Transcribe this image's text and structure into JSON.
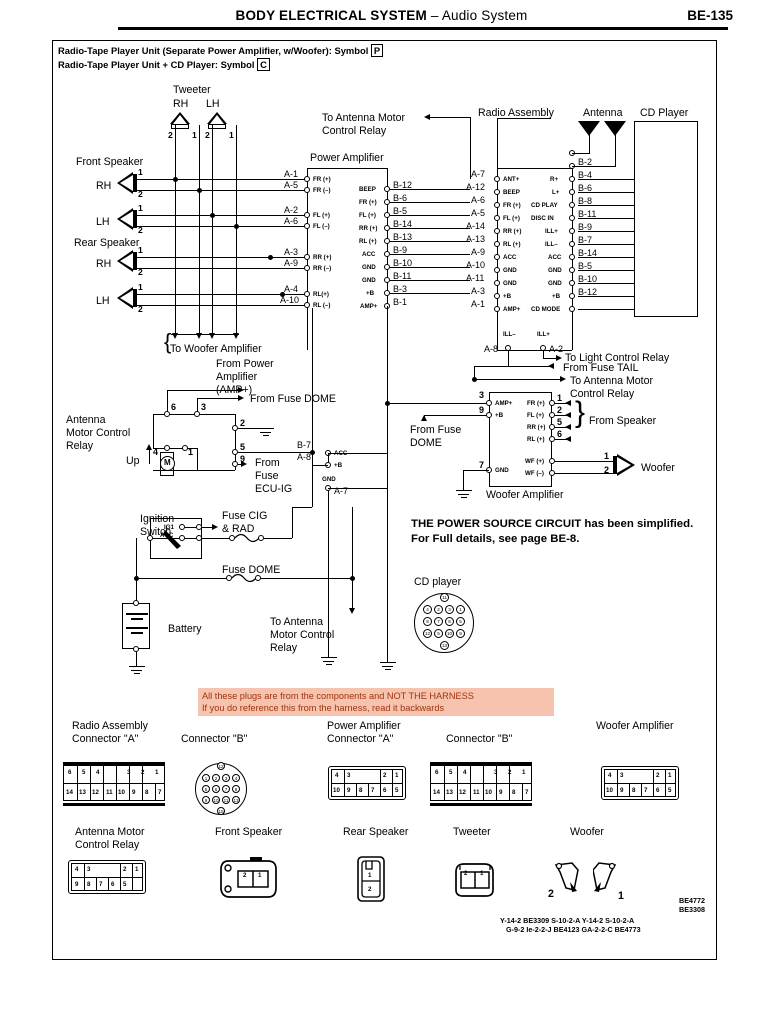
{
  "header": {
    "title_bold": "BODY ELECTRICAL SYSTEM",
    "title_dash": " – ",
    "title_thin": "Audio System",
    "page_number": "BE-135"
  },
  "legend": {
    "line1_text": "Radio-Tape Player Unit (Separate Power Amplifier, w/Woofer): Symbol",
    "line1_symbol": "P",
    "line2_text": "Radio-Tape Player Unit + CD Player: Symbol",
    "line2_symbol": "C"
  },
  "labels": {
    "tweeter": "Tweeter",
    "tweeter_rh": "RH",
    "tweeter_lh": "LH",
    "front_speaker": "Front Speaker",
    "rear_speaker": "Rear Speaker",
    "rh": "RH",
    "lh": "LH",
    "power_amplifier": "Power Amplifier",
    "radio_assembly": "Radio Assembly",
    "antenna": "Antenna",
    "cd_player": "CD Player",
    "to_antenna_motor_l1": "To Antenna Motor",
    "to_antenna_motor_l2": "Control Relay",
    "to_woofer_amplifier": "To Woofer Amplifier",
    "from_power_amp_l1": "From Power",
    "from_power_amp_l2": "Amplifier",
    "from_power_amp_l3": "(AMP+)",
    "from_fuse_dome_inline": "From Fuse DOME",
    "antenna_motor_relay_l1": "Antenna",
    "antenna_motor_relay_l2": "Motor Control",
    "antenna_motor_relay_l3": "Relay",
    "up": "Up",
    "from_fuse_ecuig_l1": "From",
    "from_fuse_ecuig_l2": "Fuse",
    "from_fuse_ecuig_l3": "ECU-IG",
    "from_fuse_dome_l1": "From Fuse",
    "from_fuse_dome_l2": "DOME",
    "ignition_switch_l1": "Ignition",
    "ignition_switch_l2": "Switch",
    "ig1": "IG1",
    "acc": "ACC",
    "fuse_cig_l1": "Fuse CIG",
    "fuse_cig_l2": "& RAD",
    "fuse_dome": "Fuse DOME",
    "battery": "Battery",
    "to_antenna_motor_relay_l1": "To Antenna",
    "to_antenna_motor_relay_l2": "Motor Control",
    "to_antenna_motor_relay_l3": "Relay",
    "to_light_control_relay": "To Light Control Relay",
    "from_fuse_tail": "From Fuse TAIL",
    "to_antenna_motor_b_l1": "To Antenna Motor",
    "to_antenna_motor_b_l2": "Control Relay",
    "from_speaker": "From Speaker",
    "woofer": "Woofer",
    "woofer_amplifier": "Woofer Amplifier",
    "power_source_l1": "THE POWER SOURCE CIRCUIT has been simplified.",
    "power_source_l2": "For Full details, see page BE-8.",
    "cd_player_connector": "CD player"
  },
  "note": {
    "line1": "All these plugs are from the components and NOT THE HARNESS",
    "line2": "If you do reference this from the harness, read it backwards",
    "bg_color": "#f6c4ae",
    "text_color": "#a0330f"
  },
  "power_amp_connector_a": {
    "pins": [
      {
        "wire": "A-1",
        "name": "FR (+)"
      },
      {
        "wire": "A-5",
        "name": "FR (–)"
      },
      {
        "wire": "A-2",
        "name": "FL (+)"
      },
      {
        "wire": "A-6",
        "name": "FL (–)"
      },
      {
        "wire": "A-3",
        "name": "RR (+)"
      },
      {
        "wire": "A-9",
        "name": "RR (–)"
      },
      {
        "wire": "A-4",
        "name": "RL(+)"
      },
      {
        "wire": "A-10",
        "name": "RL (–)"
      }
    ]
  },
  "power_amp_connector_b": {
    "pins": [
      {
        "name": "BEEP",
        "wire": "B-12"
      },
      {
        "name": "FR (+)",
        "wire": "B-6"
      },
      {
        "name": "FL (+)",
        "wire": "B-5"
      },
      {
        "name": "RR (+)",
        "wire": "B-14"
      },
      {
        "name": "RL (+)",
        "wire": "B-13"
      },
      {
        "name": "ACC",
        "wire": "B-9"
      },
      {
        "name": "GND",
        "wire": "B-10"
      },
      {
        "name": "GND",
        "wire": "B-11"
      },
      {
        "name": "+B",
        "wire": "B-3"
      },
      {
        "name": "AMP+",
        "wire": "B-1"
      }
    ]
  },
  "radio_connector_a": {
    "pins": [
      {
        "wire": "A-7",
        "name": "ANT+"
      },
      {
        "wire": "A-12",
        "name": "BEEP"
      },
      {
        "wire": "A-6",
        "name": "FR (+)"
      },
      {
        "wire": "A-5",
        "name": "FL (+)"
      },
      {
        "wire": "A-14",
        "name": "RR (+)"
      },
      {
        "wire": "A-13",
        "name": "RL (+)"
      },
      {
        "wire": "A-9",
        "name": "ACC"
      },
      {
        "wire": "A-10",
        "name": "GND"
      },
      {
        "wire": "A-11",
        "name": "GND"
      },
      {
        "wire": "A-3",
        "name": "+B"
      },
      {
        "wire": "A-1",
        "name": "AMP+"
      }
    ],
    "ill_minus": {
      "name": "ILL–",
      "wire": "A-8"
    },
    "ill_plus": {
      "name": "ILL+",
      "wire": "A-2"
    }
  },
  "radio_connector_b": {
    "pins": [
      {
        "name": "",
        "wire": "B-2"
      },
      {
        "name": "R+",
        "wire": "B-4"
      },
      {
        "name": "L+",
        "wire": "B-6"
      },
      {
        "name": "CD PLAY",
        "wire": "B-8"
      },
      {
        "name": "DISC IN",
        "wire": "B-11"
      },
      {
        "name": "ILL+",
        "wire": "B-9"
      },
      {
        "name": "ILL–",
        "wire": "B-7"
      },
      {
        "name": "ACC",
        "wire": "B-14"
      },
      {
        "name": "GND",
        "wire": "B-5"
      },
      {
        "name": "GND",
        "wire": "B-10"
      },
      {
        "name": "+B",
        "wire": "B-12"
      },
      {
        "name": "CD MODE",
        "wire": ""
      }
    ]
  },
  "woofer_amp": {
    "left_pins": [
      {
        "num": "3",
        "name": "AMP+"
      },
      {
        "num": "9",
        "name": "+B"
      },
      {
        "num": "7",
        "name": "GND"
      }
    ],
    "right_pins": [
      {
        "name": "FR (+)",
        "num": "1"
      },
      {
        "name": "FL (+)",
        "num": "2"
      },
      {
        "name": "RR (+)",
        "num": "5"
      },
      {
        "name": "RL (+)",
        "num": "6"
      }
    ],
    "woofer_pins": [
      {
        "name": "WF (+)",
        "num": "1"
      },
      {
        "name": "WF (–)",
        "num": "2"
      }
    ]
  },
  "antenna_relay": {
    "terminals": [
      "6",
      "3",
      "2",
      "5",
      "9",
      "4",
      "1"
    ]
  },
  "amp_junction": {
    "b7": "B-7",
    "acc": "ACC",
    "a8": "A-8",
    "plusb": "+B",
    "gnd": "GND",
    "a7": "A-7"
  },
  "speaker_pins": {
    "front_rh": [
      "1",
      "2"
    ],
    "front_lh": [
      "1",
      "2"
    ],
    "rear_rh": [
      "1",
      "2"
    ],
    "rear_lh": [
      "1",
      "2"
    ],
    "tweeter_rh": [
      "2",
      "1"
    ],
    "tweeter_lh": [
      "2",
      "1"
    ]
  },
  "cd_round_connector": {
    "top": "11",
    "row1": [
      "4",
      "2",
      "3",
      "1"
    ],
    "row2": [
      "8",
      "7",
      "6",
      "5"
    ],
    "row3": [
      "12",
      "5",
      "10",
      "9"
    ],
    "bottom": "13"
  },
  "connectors": [
    {
      "id": "radio-assembly-connector-a",
      "title_l1": "Radio Assembly",
      "title_l2": "Connector \"A\"",
      "type": "grid14-shroud",
      "top_row": [
        "6",
        "5",
        "4",
        "",
        "3",
        "2",
        "1"
      ],
      "bottom_row": [
        "14",
        "13",
        "12",
        "11",
        "10",
        "9",
        "8",
        "7"
      ]
    },
    {
      "id": "radio-assembly-connector-b",
      "title_l1": "Connector \"B\"",
      "title_l2": "",
      "type": "round",
      "top": "12",
      "row1": [
        "1",
        "2",
        "3",
        "4"
      ],
      "row2": [
        "5",
        "6",
        "7",
        "8"
      ],
      "row3": [
        "9",
        "10",
        "11",
        "13"
      ],
      "bottom": "15"
    },
    {
      "id": "power-amplifier-connector-a",
      "title_l1": "Power Amplifier",
      "title_l2": "Connector \"A\"",
      "type": "grid10",
      "top_row": [
        "4",
        "3",
        "",
        "2",
        "1"
      ],
      "bottom_row": [
        "10",
        "9",
        "8",
        "7",
        "6",
        "5"
      ]
    },
    {
      "id": "power-amplifier-connector-b",
      "title_l1": "Connector \"B\"",
      "title_l2": "",
      "type": "grid14-shroud",
      "top_row": [
        "6",
        "5",
        "4",
        "",
        "3",
        "2",
        "1"
      ],
      "bottom_row": [
        "14",
        "13",
        "12",
        "11",
        "10",
        "9",
        "8",
        "7"
      ]
    },
    {
      "id": "woofer-amplifier-connector",
      "title_l1": "Woofer Amplifier",
      "title_l2": "",
      "type": "grid10",
      "top_row": [
        "4",
        "3",
        "",
        "2",
        "1"
      ],
      "bottom_row": [
        "10",
        "9",
        "8",
        "7",
        "6",
        "5"
      ]
    },
    {
      "id": "antenna-motor-control-relay-connector",
      "title_l1": "Antenna Motor",
      "title_l2": "Control Relay",
      "type": "grid10",
      "top_row": [
        "4",
        "3",
        "",
        "2",
        "1"
      ],
      "bottom_row": [
        "9",
        "8",
        "7",
        "6",
        "5"
      ]
    },
    {
      "id": "front-speaker-connector",
      "title_l1": "Front Speaker",
      "title_l2": "",
      "type": "speaker2",
      "pins": [
        "2",
        "1"
      ]
    },
    {
      "id": "rear-speaker-connector",
      "title_l1": "Rear Speaker",
      "title_l2": "",
      "type": "speaker-vert",
      "pins": [
        "1",
        "2"
      ]
    },
    {
      "id": "tweeter-connector",
      "title_l1": "Tweeter",
      "title_l2": "",
      "type": "tweeter2",
      "pins": [
        "2",
        "1"
      ]
    },
    {
      "id": "woofer-connector",
      "title_l1": "Woofer",
      "title_l2": "",
      "type": "woofer-pair",
      "pins": [
        "2",
        "1"
      ]
    }
  ],
  "footer": {
    "code1": "BE4772",
    "code2": "BE3308",
    "line1": "Y-14-2 BE3309 S-10-2-A Y-14-2 S-10-2-A",
    "line2": "G-9-2 Ie-2-2-J BE4123 GA-2-2-C BE4773"
  }
}
